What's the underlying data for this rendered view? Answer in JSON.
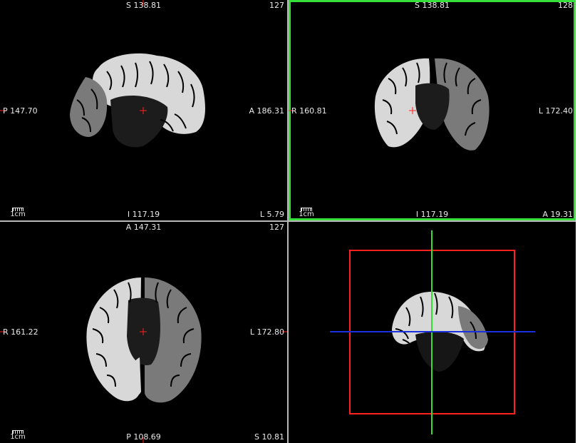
{
  "views": {
    "sagittal": {
      "slice": "127",
      "top": "S 138.81",
      "bottom": "I 117.19",
      "left": "P 147.70",
      "right": "A 186.31",
      "corner": "L 5.79",
      "scale": "1cm"
    },
    "coronal": {
      "slice": "128",
      "top": "S 138.81",
      "bottom": "I 117.19",
      "left": "R 160.81",
      "right": "L 172.40",
      "corner": "A 19.31",
      "scale": "1cm"
    },
    "axial": {
      "slice": "127",
      "top": "A 147.31",
      "bottom": "P 108.69",
      "left": "R 161.22",
      "right": "L 172.80",
      "corner": "S 10.81",
      "scale": "1cm"
    }
  },
  "colors": {
    "active_border": "#36e03a",
    "cursor": "#ff2020",
    "plane_sagittal": "#ff2020",
    "plane_coronal": "#33dd33",
    "plane_axial": "#1a2fdd",
    "cortex_bright": "#d8d8d8",
    "cortex_dim": "#7a7a7a"
  },
  "active_view": "coronal"
}
